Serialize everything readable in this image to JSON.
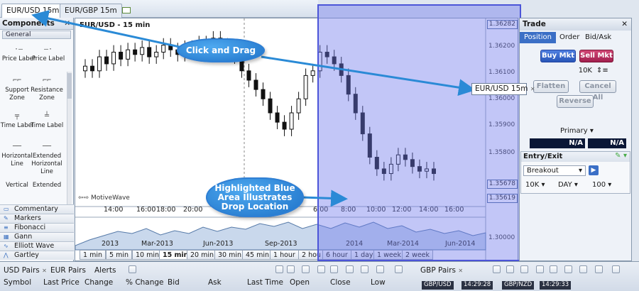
{
  "tabs": [
    {
      "label": "EUR/USD 15m",
      "active": true
    },
    {
      "label": "EUR/GBP 15m",
      "active": false
    }
  ],
  "components": {
    "title": "Components",
    "category": "General",
    "tools": [
      "Price Label",
      "Price Label",
      "Support Zone",
      "Resistance Zone",
      "Time Label",
      "Time Label",
      "Horizontal Line",
      "Extended Horizontal Line",
      "Vertical",
      "Extended"
    ],
    "categories": [
      "Commentary",
      "Markers",
      "Fibonacci",
      "Gann",
      "Elliott Wave",
      "Gartley"
    ]
  },
  "chart": {
    "title": "EUR/USD - 15 min",
    "brand": "MotiveWave",
    "prices": [
      "1.36282",
      "1.36200",
      "1.36100",
      "1.36000",
      "1.35900",
      "1.35800",
      "1.35678",
      "1.35619",
      "1.30000"
    ],
    "time_labels": [
      "14:00",
      "16:00",
      "18:00",
      "20:00",
      "6:00",
      "8:00",
      "10:00",
      "12:00",
      "14:00",
      "16:00"
    ],
    "overview_labels": [
      "2013",
      "Mar-2013",
      "Jun-2013",
      "Sep-2013",
      "2014",
      "Mar-2014",
      "Jun-2014"
    ],
    "timeframes": [
      "1 min",
      "5 min",
      "10 min",
      "15 min",
      "20 min",
      "30 min",
      "45 min",
      "1 hour",
      "2 hou",
      "6 hour",
      "1 day",
      "1 week",
      "2 week"
    ],
    "selected_timeframe": "15 min"
  },
  "callouts": {
    "click_drag": "Click and Drag",
    "highlight": "Highlighted Blue Area Illustrates Drop Location",
    "dragged_tab": "EUR/USD 15m"
  },
  "trade": {
    "title": "Trade",
    "tabs": [
      "Position",
      "Order",
      "Bid/Ask"
    ],
    "buy": "Buy Mkt",
    "sell": "Sell Mkt",
    "quantity": "10K",
    "flatten": "Flatten",
    "cancel_all": "Cancel All",
    "reverse": "Reverse",
    "position_type": "Primary",
    "na": [
      "N/A",
      "N/A"
    ],
    "entry_exit": "Entry/Exit",
    "strategy": "Breakout",
    "qty2": "10K",
    "tif": "DAY",
    "val": "100"
  },
  "bottom": {
    "tabs": [
      "USD Pairs",
      "EUR Pairs",
      "Alerts"
    ],
    "columns": [
      "Symbol",
      "Last Price",
      "Change",
      "% Change",
      "Bid",
      "Ask",
      "Last Time",
      "Open",
      "Close",
      "Low"
    ],
    "right_tab": "GBP Pairs",
    "clocks": [
      "GBP/USD",
      "14:29:28",
      "GBP/NZD",
      "14:29:33"
    ]
  },
  "chart_data": {
    "type": "candlestick",
    "title": "EUR/USD - 15 min",
    "ylim": [
      1.3556,
      1.3632
    ],
    "close": [
      1.3614,
      1.3612,
      1.3618,
      1.3615,
      1.362,
      1.3617,
      1.3621,
      1.3619,
      1.3622,
      1.3618,
      1.362,
      1.3623,
      1.3621,
      1.3619,
      1.3622,
      1.362,
      1.3624,
      1.3621,
      1.3626,
      1.3623,
      1.362,
      1.3618,
      1.3612,
      1.3608,
      1.3604,
      1.36,
      1.3594,
      1.359,
      1.3587,
      1.3594,
      1.36,
      1.361,
      1.3612,
      1.362,
      1.3618,
      1.3615,
      1.361,
      1.3602,
      1.3594,
      1.3585,
      1.3575,
      1.357,
      1.3568,
      1.3572,
      1.3576,
      1.3574,
      1.3571,
      1.3569,
      1.357,
      1.3568
    ]
  }
}
